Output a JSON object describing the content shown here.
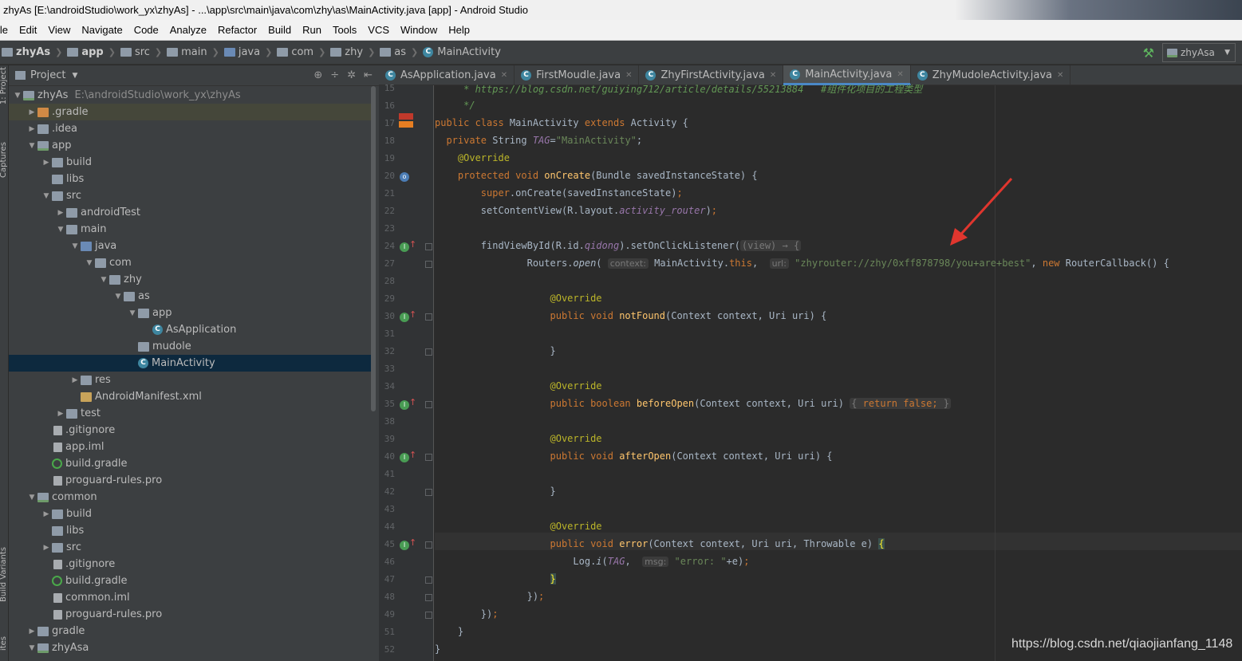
{
  "window": {
    "title": "zhyAs [E:\\androidStudio\\work_yx\\zhyAs] - ...\\app\\src\\main\\java\\com\\zhy\\as\\MainActivity.java [app] - Android Studio"
  },
  "menu": [
    "ile",
    "Edit",
    "View",
    "Navigate",
    "Code",
    "Analyze",
    "Refactor",
    "Build",
    "Run",
    "Tools",
    "VCS",
    "Window",
    "Help"
  ],
  "breadcrumb": [
    "zhyAs",
    "app",
    "src",
    "main",
    "java",
    "com",
    "zhy",
    "as",
    "MainActivity"
  ],
  "run_config": "zhyAsa",
  "left_strip": {
    "project": "1: Project",
    "captures": "Captures",
    "build_variants": "Build Variants",
    "favorites": "ites"
  },
  "project_panel": {
    "title": "Project",
    "tree": [
      {
        "label": "zhyAs",
        "path": "E:\\androidStudio\\work_yx\\zhyAs",
        "indent": 0,
        "toggle": "down",
        "icon": "folder-mod"
      },
      {
        "label": ".gradle",
        "indent": 1,
        "toggle": "right",
        "icon": "folder-orange"
      },
      {
        "label": ".idea",
        "indent": 1,
        "toggle": "right",
        "icon": "folder"
      },
      {
        "label": "app",
        "indent": 1,
        "toggle": "down",
        "icon": "folder-mod"
      },
      {
        "label": "build",
        "indent": 2,
        "toggle": "right",
        "icon": "folder"
      },
      {
        "label": "libs",
        "indent": 2,
        "toggle": "",
        "icon": "folder"
      },
      {
        "label": "src",
        "indent": 2,
        "toggle": "down",
        "icon": "folder"
      },
      {
        "label": "androidTest",
        "indent": 3,
        "toggle": "right",
        "icon": "folder"
      },
      {
        "label": "main",
        "indent": 3,
        "toggle": "down",
        "icon": "folder"
      },
      {
        "label": "java",
        "indent": 4,
        "toggle": "down",
        "icon": "folder-blue"
      },
      {
        "label": "com",
        "indent": 5,
        "toggle": "down",
        "icon": "folder"
      },
      {
        "label": "zhy",
        "indent": 6,
        "toggle": "down",
        "icon": "folder"
      },
      {
        "label": "as",
        "indent": 7,
        "toggle": "down",
        "icon": "folder"
      },
      {
        "label": "app",
        "indent": 8,
        "toggle": "down",
        "icon": "folder"
      },
      {
        "label": "AsApplication",
        "indent": 9,
        "toggle": "",
        "icon": "cls"
      },
      {
        "label": "mudole",
        "indent": 8,
        "toggle": "",
        "icon": "folder"
      },
      {
        "label": "MainActivity",
        "indent": 8,
        "toggle": "",
        "icon": "cls",
        "selected": true
      },
      {
        "label": "res",
        "indent": 4,
        "toggle": "right",
        "icon": "folder"
      },
      {
        "label": "AndroidManifest.xml",
        "indent": 4,
        "toggle": "",
        "icon": "xml"
      },
      {
        "label": "test",
        "indent": 3,
        "toggle": "right",
        "icon": "folder"
      },
      {
        "label": ".gitignore",
        "indent": 2,
        "toggle": "",
        "icon": "file"
      },
      {
        "label": "app.iml",
        "indent": 2,
        "toggle": "",
        "icon": "file"
      },
      {
        "label": "build.gradle",
        "indent": 2,
        "toggle": "",
        "icon": "grad"
      },
      {
        "label": "proguard-rules.pro",
        "indent": 2,
        "toggle": "",
        "icon": "file"
      },
      {
        "label": "common",
        "indent": 1,
        "toggle": "down",
        "icon": "folder-mod"
      },
      {
        "label": "build",
        "indent": 2,
        "toggle": "right",
        "icon": "folder"
      },
      {
        "label": "libs",
        "indent": 2,
        "toggle": "",
        "icon": "folder"
      },
      {
        "label": "src",
        "indent": 2,
        "toggle": "right",
        "icon": "folder"
      },
      {
        "label": ".gitignore",
        "indent": 2,
        "toggle": "",
        "icon": "file"
      },
      {
        "label": "build.gradle",
        "indent": 2,
        "toggle": "",
        "icon": "grad"
      },
      {
        "label": "common.iml",
        "indent": 2,
        "toggle": "",
        "icon": "file"
      },
      {
        "label": "proguard-rules.pro",
        "indent": 2,
        "toggle": "",
        "icon": "file"
      },
      {
        "label": "gradle",
        "indent": 1,
        "toggle": "right",
        "icon": "folder"
      },
      {
        "label": "zhyAsa",
        "indent": 1,
        "toggle": "down",
        "icon": "folder-mod"
      }
    ]
  },
  "tabs": [
    {
      "label": "AsApplication.java",
      "active": false
    },
    {
      "label": "FirstMoudle.java",
      "active": false
    },
    {
      "label": "ZhyFirstActivity.java",
      "active": false
    },
    {
      "label": "MainActivity.java",
      "active": true
    },
    {
      "label": "ZhyMudoleActivity.java",
      "active": false
    }
  ],
  "code_lines": [
    {
      "n": "15",
      "html": "    <span class=\"cm\"> * https://blog.csdn.net/guiying712/article/details/55213884   #组件化项目的工程类型</span>"
    },
    {
      "n": "16",
      "html": "    <span class=\"cm\"> */</span>"
    },
    {
      "n": "17",
      "html": "<span class=\"kw\">public class </span>MainActivity <span class=\"kw\">extends </span>Activity {"
    },
    {
      "n": "18",
      "html": "  <span class=\"kw\">private </span>String <span class=\"it\">TAG</span>=<span class=\"st\">\"MainActivity\"</span>;"
    },
    {
      "n": "19",
      "html": "    <span class=\"an\">@Override</span>"
    },
    {
      "n": "20",
      "html": "    <span class=\"kw\">protected void </span><span class=\"fn\">onCreate</span>(Bundle savedInstanceState) {"
    },
    {
      "n": "21",
      "html": "        <span class=\"kw\">super</span>.onCreate(savedInstanceState)<span class=\"kw\">;</span>"
    },
    {
      "n": "22",
      "html": "        setContentView(R.layout.<span class=\"it\">activity_router</span>)<span class=\"kw\">;</span>"
    },
    {
      "n": "23",
      "html": ""
    },
    {
      "n": "24",
      "html": "        findViewById(R.id.<span class=\"it\">qidong</span>).setOnClickListener(<span class=\"lmb\">(view) → {</span>"
    },
    {
      "n": "27",
      "html": "                Routers.<span style=\"font-style:italic\">open</span>( <span class=\"hint\">context:</span> MainActivity.<span class=\"kw\">this</span>,  <span class=\"hint\">url:</span> <span class=\"st\">\"zhyrouter://zhy/0xff878798/you+are+best\"</span>, <span class=\"kw\">new </span>RouterCallback() {"
    },
    {
      "n": "28",
      "html": ""
    },
    {
      "n": "29",
      "html": "                    <span class=\"an\">@Override</span>"
    },
    {
      "n": "30",
      "html": "                    <span class=\"kw\">public void </span><span class=\"fn\">notFound</span>(Context context, Uri uri) {"
    },
    {
      "n": "31",
      "html": ""
    },
    {
      "n": "32",
      "html": "                    }"
    },
    {
      "n": "33",
      "html": ""
    },
    {
      "n": "34",
      "html": "                    <span class=\"an\">@Override</span>"
    },
    {
      "n": "35",
      "html": "                    <span class=\"kw\">public boolean </span><span class=\"fn\">beforeOpen</span>(Context context, Uri uri) <span class=\"lmb\">{ <span class=\"kw\">return false;</span> }</span>"
    },
    {
      "n": "38",
      "html": ""
    },
    {
      "n": "39",
      "html": "                    <span class=\"an\">@Override</span>"
    },
    {
      "n": "40",
      "html": "                    <span class=\"kw\">public void </span><span class=\"fn\">afterOpen</span>(Context context, Uri uri) {"
    },
    {
      "n": "41",
      "html": ""
    },
    {
      "n": "42",
      "html": "                    }"
    },
    {
      "n": "43",
      "html": ""
    },
    {
      "n": "44",
      "html": "                    <span class=\"an\">@Override</span>"
    },
    {
      "n": "45",
      "html": "                    <span class=\"kw\">public void </span><span class=\"fn\">error</span>(Context context, Uri uri, Throwable e) <span style=\"background:#3b514d;color:#ffef28\">{</span>"
    },
    {
      "n": "46",
      "html": "                        Log.<span style=\"font-style:italic\">i</span>(<span class=\"it\">TAG</span>,  <span class=\"hint\">msg:</span> <span class=\"st\">\"error: \"</span>+e)<span class=\"kw\">;</span>"
    },
    {
      "n": "47",
      "html": "                    <span style=\"background:#3b514d;color:#ffef28\">}</span>"
    },
    {
      "n": "48",
      "html": "                })<span class=\"kw\">;</span>"
    },
    {
      "n": "49",
      "html": "        })<span class=\"kw\">;</span>"
    },
    {
      "n": "51",
      "html": "    }"
    },
    {
      "n": "52",
      "html": "}"
    }
  ],
  "watermark": "https://blog.csdn.net/qiaojianfang_1148"
}
